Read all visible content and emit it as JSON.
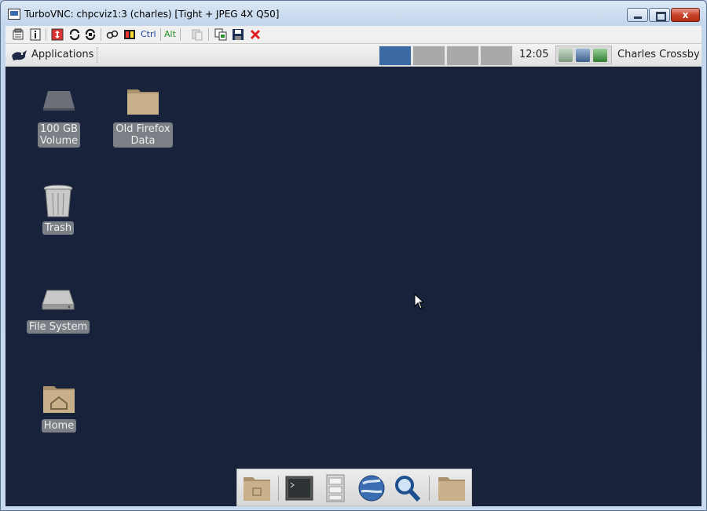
{
  "window": {
    "title": "TurboVNC: chpcviz1:3 (charles) [Tight + JPEG 4X Q50]",
    "close_glyph": "x"
  },
  "vnc_toolbar": {
    "ctrl_label": "Ctrl",
    "alt_label": "Alt",
    "icons": [
      "options-icon",
      "info-icon",
      "fullscreen-icon",
      "refresh-icon",
      "refresh-request-icon",
      "ctrl-alt-del-icon",
      "screenshot-icon",
      "clipboard-icon",
      "copy-icon",
      "save-icon",
      "disconnect-icon"
    ]
  },
  "panel": {
    "applications_label": "Applications",
    "clock": "12:05",
    "user_name": "Charles Crossby",
    "workspaces": [
      {
        "name": "workspace-1",
        "active": true
      },
      {
        "name": "workspace-2",
        "active": false
      },
      {
        "name": "workspace-3",
        "active": false
      },
      {
        "name": "workspace-4",
        "active": false
      }
    ]
  },
  "desktop": {
    "icons": [
      {
        "name": "volume",
        "label_line1": "100 GB",
        "label_line2": "Volume",
        "icon": "drive-icon"
      },
      {
        "name": "old-firefox-data",
        "label_line1": "Old Firefox",
        "label_line2": "Data",
        "icon": "folder-icon"
      },
      {
        "name": "trash",
        "label": "Trash",
        "icon": "trash-icon"
      },
      {
        "name": "file-system",
        "label": "File System",
        "icon": "harddisk-icon"
      },
      {
        "name": "home",
        "label": "Home",
        "icon": "home-folder-icon"
      }
    ]
  },
  "dock": {
    "items": [
      "downloads-folder-icon",
      "terminal-icon",
      "file-cabinet-icon",
      "web-browser-icon",
      "search-icon",
      "folder-icon"
    ]
  },
  "colors": {
    "desktop_bg": "#18223a",
    "workspace_active": "#3d6aa5",
    "workspace_inactive": "#a9a9a9",
    "label_bg": "#7b7f86"
  }
}
